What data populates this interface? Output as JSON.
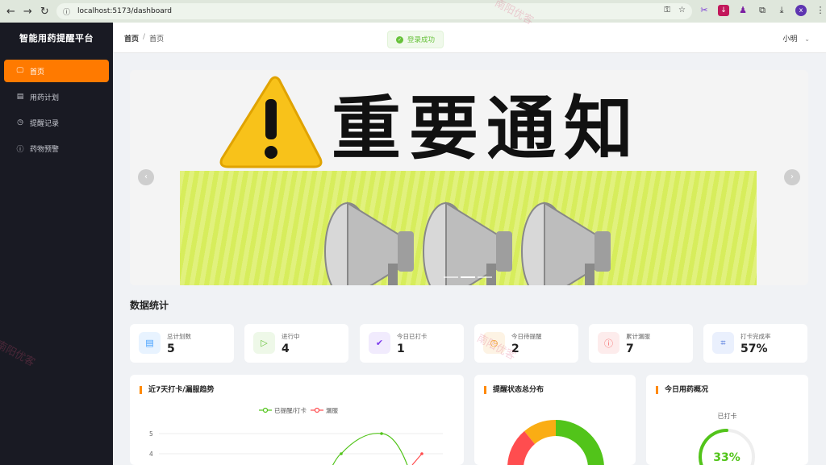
{
  "browser": {
    "url": "localhost:5173/dashboard"
  },
  "sidebar": {
    "title": "智能用药提醒平台",
    "items": [
      {
        "label": "首页",
        "icon": "monitor-icon",
        "active": true
      },
      {
        "label": "用药计划",
        "icon": "notebook-icon",
        "active": false
      },
      {
        "label": "提醒记录",
        "icon": "clock-icon",
        "active": false
      },
      {
        "label": "药物预警",
        "icon": "warning-circle-icon",
        "active": false
      }
    ]
  },
  "header": {
    "breadcrumb": [
      "首页",
      "首页"
    ],
    "toast": "登录成功",
    "user": "小明"
  },
  "banner": {
    "title": "重要通知",
    "slides": 3,
    "active_slide": 2
  },
  "stats": {
    "title": "数据统计",
    "items": [
      {
        "label": "总计划数",
        "value": "5",
        "icon": "document-icon",
        "color": "#409eff",
        "bg": "#e8f3ff"
      },
      {
        "label": "进行中",
        "value": "4",
        "icon": "play-icon",
        "color": "#67c23a",
        "bg": "#eef8e8"
      },
      {
        "label": "今日已打卡",
        "value": "1",
        "icon": "check-icon",
        "color": "#7c3aed",
        "bg": "#f1ebfd"
      },
      {
        "label": "今日待提醒",
        "value": "2",
        "icon": "clock-icon",
        "color": "#f5a623",
        "bg": "#fdf3e4"
      },
      {
        "label": "累计漏服",
        "value": "7",
        "icon": "warning-circle-icon",
        "color": "#f56c6c",
        "bg": "#fdecec"
      },
      {
        "label": "打卡完成率",
        "value": "57%",
        "icon": "chart-board-icon",
        "color": "#3f6ad8",
        "bg": "#eaf0fd"
      }
    ]
  },
  "cards": {
    "trend": {
      "title": "近7天打卡/漏服趋势",
      "legend": [
        "已提醒/打卡",
        "漏服"
      ],
      "y_ticks": [
        "5",
        "4"
      ]
    },
    "distribution": {
      "title": "提醒状态总分布"
    },
    "today": {
      "title": "今日用药概况",
      "label": "已打卡",
      "percent": "33%",
      "fraction": 0.33
    }
  },
  "colors": {
    "accent": "#ff7a00",
    "sidebar_bg": "#191a23",
    "green": "#52c41a",
    "red": "#ff4d4f",
    "orange": "#faad14"
  },
  "watermark": "南阳优客"
}
